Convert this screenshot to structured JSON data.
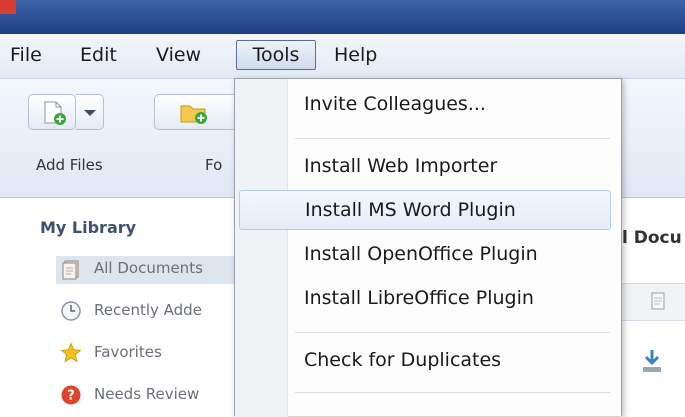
{
  "menubar": {
    "items": [
      "File",
      "Edit",
      "View",
      "Tools",
      "Help"
    ],
    "active": "Tools"
  },
  "toolbar": {
    "add_files_label": "Add Files",
    "folder_label_partial": "Fo"
  },
  "sidebar": {
    "title": "My Library",
    "items": [
      {
        "label": "All Documents",
        "icon": "documents-icon"
      },
      {
        "label": "Recently Adde",
        "icon": "clock-icon"
      },
      {
        "label": "Favorites",
        "icon": "star-icon"
      },
      {
        "label": "Needs Review",
        "icon": "review-icon"
      }
    ]
  },
  "content": {
    "header_partial": "l Docu"
  },
  "tools_menu": {
    "items": [
      {
        "label": "Invite Colleagues..."
      },
      {
        "label": "Install Web Importer"
      },
      {
        "label": "Install MS Word Plugin",
        "highlighted": true
      },
      {
        "label": "Install OpenOffice Plugin"
      },
      {
        "label": "Install LibreOffice Plugin"
      },
      {
        "label": "Check for Duplicates"
      }
    ]
  },
  "colors": {
    "titlebar": "#2c4f96",
    "highlight_border": "#b6cbe6",
    "star": "#f2c21b",
    "review": "#e0442c"
  }
}
